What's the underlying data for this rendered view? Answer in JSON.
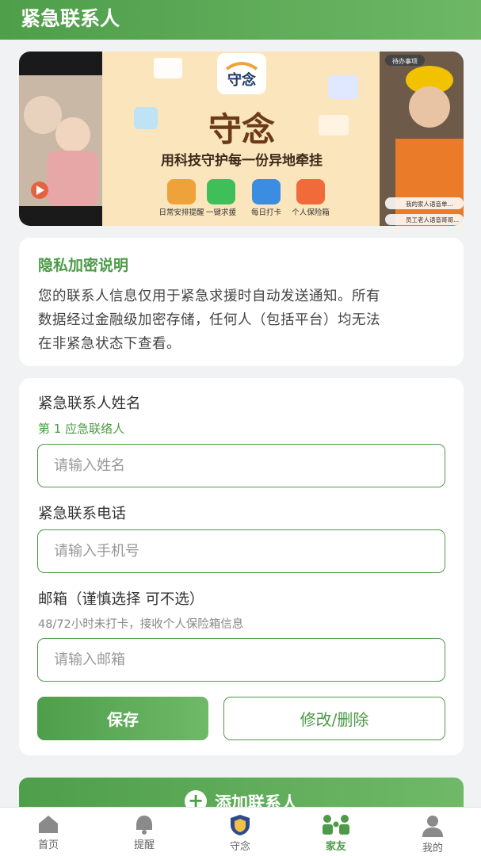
{
  "header": {
    "title": "紧急联系人"
  },
  "banner": {
    "app_icon_text": "守念",
    "title": "守念",
    "slogan": "用科技守护每一份异地牵挂",
    "features": [
      {
        "label": "日常安排提醒",
        "color": "#f0a23a"
      },
      {
        "label": "一键求援",
        "color": "#3fbf5a"
      },
      {
        "label": "每日打卡",
        "color": "#3a8de0"
      },
      {
        "label": "个人保险箱",
        "color": "#f06a3a"
      }
    ],
    "right_tag": "待办事项",
    "chat_bubbles": [
      "我的家人语音单...",
      "员工老人语音哥哥..."
    ]
  },
  "privacy": {
    "title": "隐私加密说明",
    "lines": [
      "您的联系人信息仅用于紧急求援时自动发送通知。所有",
      "数据经过金融级加密存储，任何人（包括平台）均无法",
      "在非紧急状态下查看。"
    ]
  },
  "form": {
    "name_label": "紧急联系人姓名",
    "name_sublabel": "第 1 应急联络人",
    "name_placeholder": "请输入姓名",
    "phone_label": "紧急联系电话",
    "phone_placeholder": "请输入手机号",
    "email_label": "邮箱（谨慎选择 可不选）",
    "email_hint": "48/72小时未打卡，接收个人保险箱信息",
    "email_placeholder": "请输入邮箱",
    "save_label": "保存",
    "edit_label": "修改/删除"
  },
  "add_button": {
    "label": "添加联系人"
  },
  "tabbar": {
    "active": "家友",
    "items": [
      {
        "label": "首页",
        "icon": "home-icon"
      },
      {
        "label": "提醒",
        "icon": "bell-icon"
      },
      {
        "label": "守念",
        "icon": "shield-icon"
      },
      {
        "label": "家友",
        "icon": "family-icon"
      },
      {
        "label": "我的",
        "icon": "user-icon"
      }
    ]
  },
  "colors": {
    "accent": "#4d9a48",
    "background": "#f1f2f4"
  }
}
